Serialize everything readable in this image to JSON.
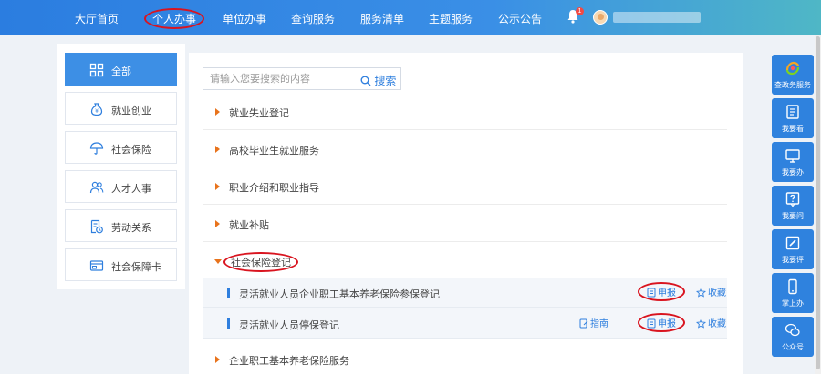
{
  "nav": {
    "items": [
      {
        "label": "大厅首页"
      },
      {
        "label": "个人办事"
      },
      {
        "label": "单位办事"
      },
      {
        "label": "查询服务"
      },
      {
        "label": "服务清单"
      },
      {
        "label": "主题服务"
      },
      {
        "label": "公示公告"
      }
    ],
    "active": "个人办事",
    "notification_count": "1"
  },
  "categories": [
    {
      "label": "全部",
      "icon": "grid-icon",
      "active": true
    },
    {
      "label": "就业创业",
      "icon": "coin-bag-icon"
    },
    {
      "label": "社会保险",
      "icon": "umbrella-icon"
    },
    {
      "label": "人才人事",
      "icon": "people-icon"
    },
    {
      "label": "劳动关系",
      "icon": "document-clock-icon"
    },
    {
      "label": "社会保障卡",
      "icon": "card-icon"
    }
  ],
  "search": {
    "placeholder": "请输入您要搜索的内容",
    "button_label": "搜索"
  },
  "services": [
    {
      "label": "就业失业登记"
    },
    {
      "label": "高校毕业生就业服务"
    },
    {
      "label": "职业介绍和职业指导"
    },
    {
      "label": "就业补贴"
    },
    {
      "label": "社会保险登记",
      "expanded": true
    },
    {
      "label": "企业职工基本养老保险服务"
    }
  ],
  "sub_items": [
    {
      "label": "灵活就业人员企业职工基本养老保险参保登记",
      "apply": "申报",
      "favorite": "收藏"
    },
    {
      "label": "灵活就业人员停保登记",
      "guide": "指南",
      "apply": "申报",
      "favorite": "收藏"
    }
  ],
  "side_rail": [
    {
      "label": "查政务服务",
      "icon": "service-logo-icon"
    },
    {
      "label": "我要看",
      "icon": "book-icon"
    },
    {
      "label": "我要办",
      "icon": "monitor-icon"
    },
    {
      "label": "我要问",
      "icon": "question-icon"
    },
    {
      "label": "我要评",
      "icon": "edit-icon"
    },
    {
      "label": "掌上办",
      "icon": "phone-icon"
    },
    {
      "label": "公众号",
      "icon": "wechat-icon"
    }
  ],
  "colors": {
    "primary": "#2f7fde",
    "accent_arrow": "#e8731c",
    "annotation_red": "#d9141f"
  }
}
